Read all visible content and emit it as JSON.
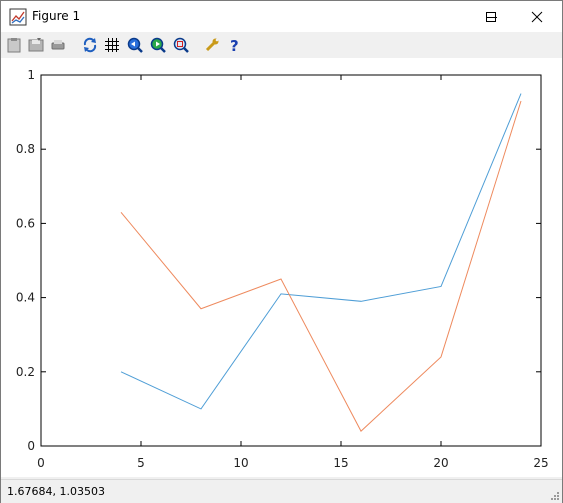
{
  "window": {
    "title": "Figure 1",
    "minimize_icon": "minimize-icon",
    "maximize_icon": "maximize-icon",
    "close_icon": "close-icon"
  },
  "toolbar": {
    "buttons": [
      {
        "name": "copy-button",
        "icon": "clipboard-icon"
      },
      {
        "name": "save-button",
        "icon": "save-icon"
      },
      {
        "name": "print-button",
        "icon": "printer-icon"
      },
      {
        "name": "autoscale-button",
        "icon": "rotate-icon"
      },
      {
        "name": "grid-button",
        "icon": "grid-icon"
      },
      {
        "name": "zoom-out-button",
        "icon": "zoom-out-icon"
      },
      {
        "name": "zoom-in-button",
        "icon": "zoom-in-icon"
      },
      {
        "name": "zoom-box-button",
        "icon": "zoom-box-icon"
      },
      {
        "name": "settings-button",
        "icon": "wrench-icon"
      },
      {
        "name": "help-button",
        "icon": "help-icon"
      }
    ]
  },
  "status": {
    "coords": "1.67684,  1.03503"
  },
  "colors": {
    "series1": "#4f9ed6",
    "series2": "#ee8a5e",
    "axis": "#000000"
  },
  "chart_data": {
    "type": "line",
    "title": "",
    "xlabel": "",
    "ylabel": "",
    "xlim": [
      0,
      25
    ],
    "ylim": [
      0,
      1
    ],
    "xticks": [
      "0",
      "5",
      "10",
      "15",
      "20",
      "25"
    ],
    "yticks": [
      "0",
      "0.2",
      "0.4",
      "0.6",
      "0.8",
      "1"
    ],
    "grid": false,
    "x": [
      4,
      8,
      12,
      16,
      20,
      24
    ],
    "series": [
      {
        "values": [
          0.2,
          0.1,
          0.41,
          0.39,
          0.43,
          0.95
        ]
      },
      {
        "values": [
          0.63,
          0.37,
          0.45,
          0.04,
          0.24,
          0.93
        ]
      }
    ]
  }
}
